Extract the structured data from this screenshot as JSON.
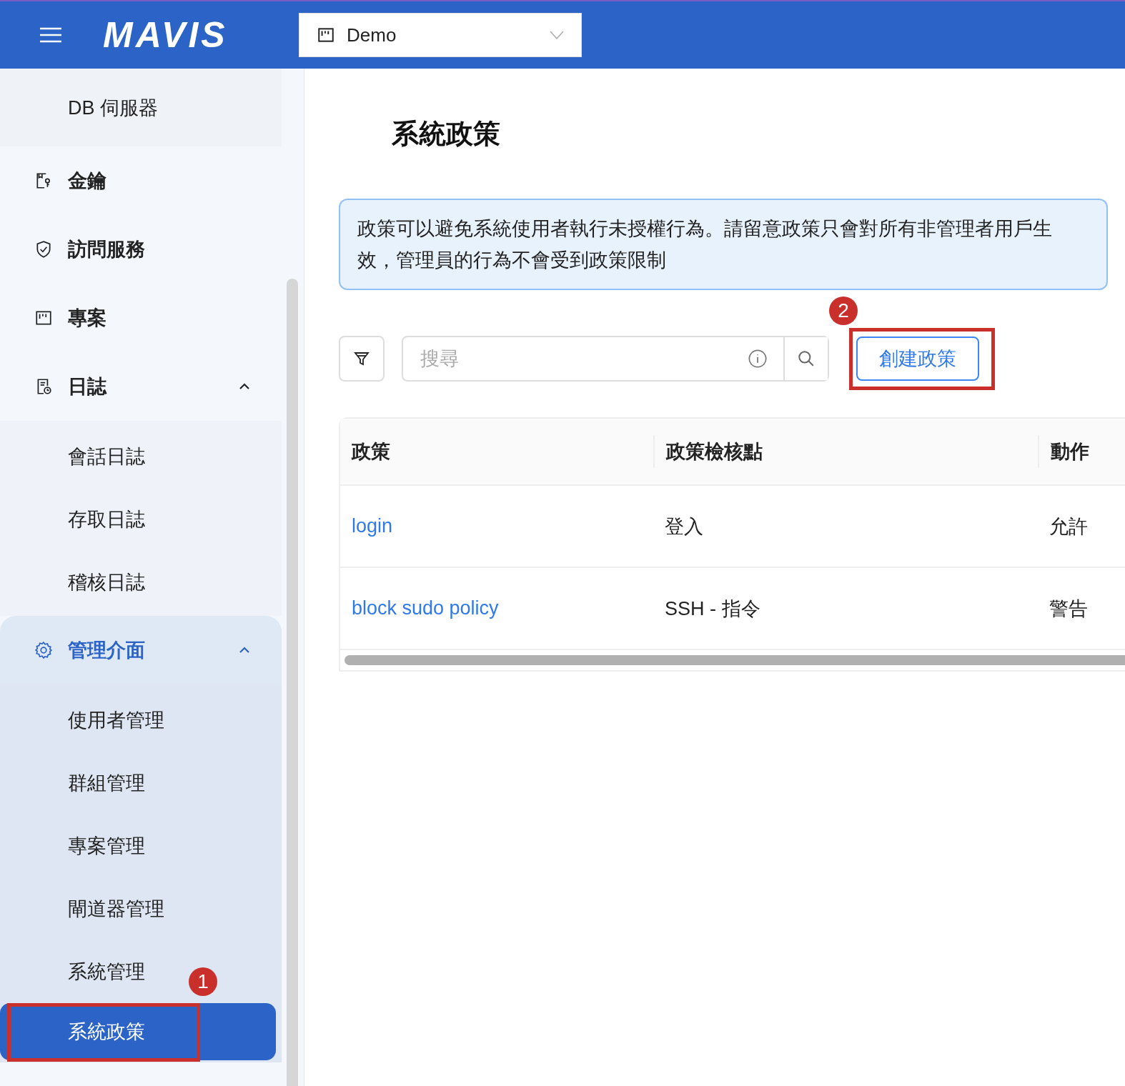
{
  "header": {
    "logo": "MAVIS",
    "project_select": {
      "value": "Demo"
    }
  },
  "sidebar": {
    "items": [
      {
        "label": "DB 伺服器",
        "kind": "sub",
        "selected": false
      },
      {
        "label": "金鑰",
        "kind": "item",
        "selected": false
      },
      {
        "label": "訪問服務",
        "kind": "item",
        "selected": false
      },
      {
        "label": "專案",
        "kind": "item",
        "selected": false
      },
      {
        "label": "日誌",
        "kind": "group",
        "expanded": true,
        "selected": false,
        "children": [
          {
            "label": "會話日誌",
            "selected": false
          },
          {
            "label": "存取日誌",
            "selected": false
          },
          {
            "label": "稽核日誌",
            "selected": false
          }
        ]
      },
      {
        "label": "管理介面",
        "kind": "group",
        "expanded": true,
        "selected": true,
        "children": [
          {
            "label": "使用者管理",
            "selected": false
          },
          {
            "label": "群組管理",
            "selected": false
          },
          {
            "label": "專案管理",
            "selected": false
          },
          {
            "label": "閘道器管理",
            "selected": false
          },
          {
            "label": "系統管理",
            "selected": false
          },
          {
            "label": "系統政策",
            "selected": true,
            "annotation": "1"
          }
        ]
      }
    ]
  },
  "page": {
    "title": "系統政策",
    "notice": "政策可以避免系統使用者執行未授權行為。請留意政策只會對所有非管理者用戶生效，管理員的行為不會受到政策限制",
    "search": {
      "placeholder": "搜尋"
    },
    "create_button": {
      "label": "創建政策",
      "annotation": "2"
    },
    "table": {
      "columns": [
        "政策",
        "政策檢核點",
        "動作"
      ],
      "rows": [
        [
          "login",
          "登入",
          "允許"
        ],
        [
          "block sudo policy",
          "SSH - 指令",
          "警告"
        ]
      ]
    }
  }
}
